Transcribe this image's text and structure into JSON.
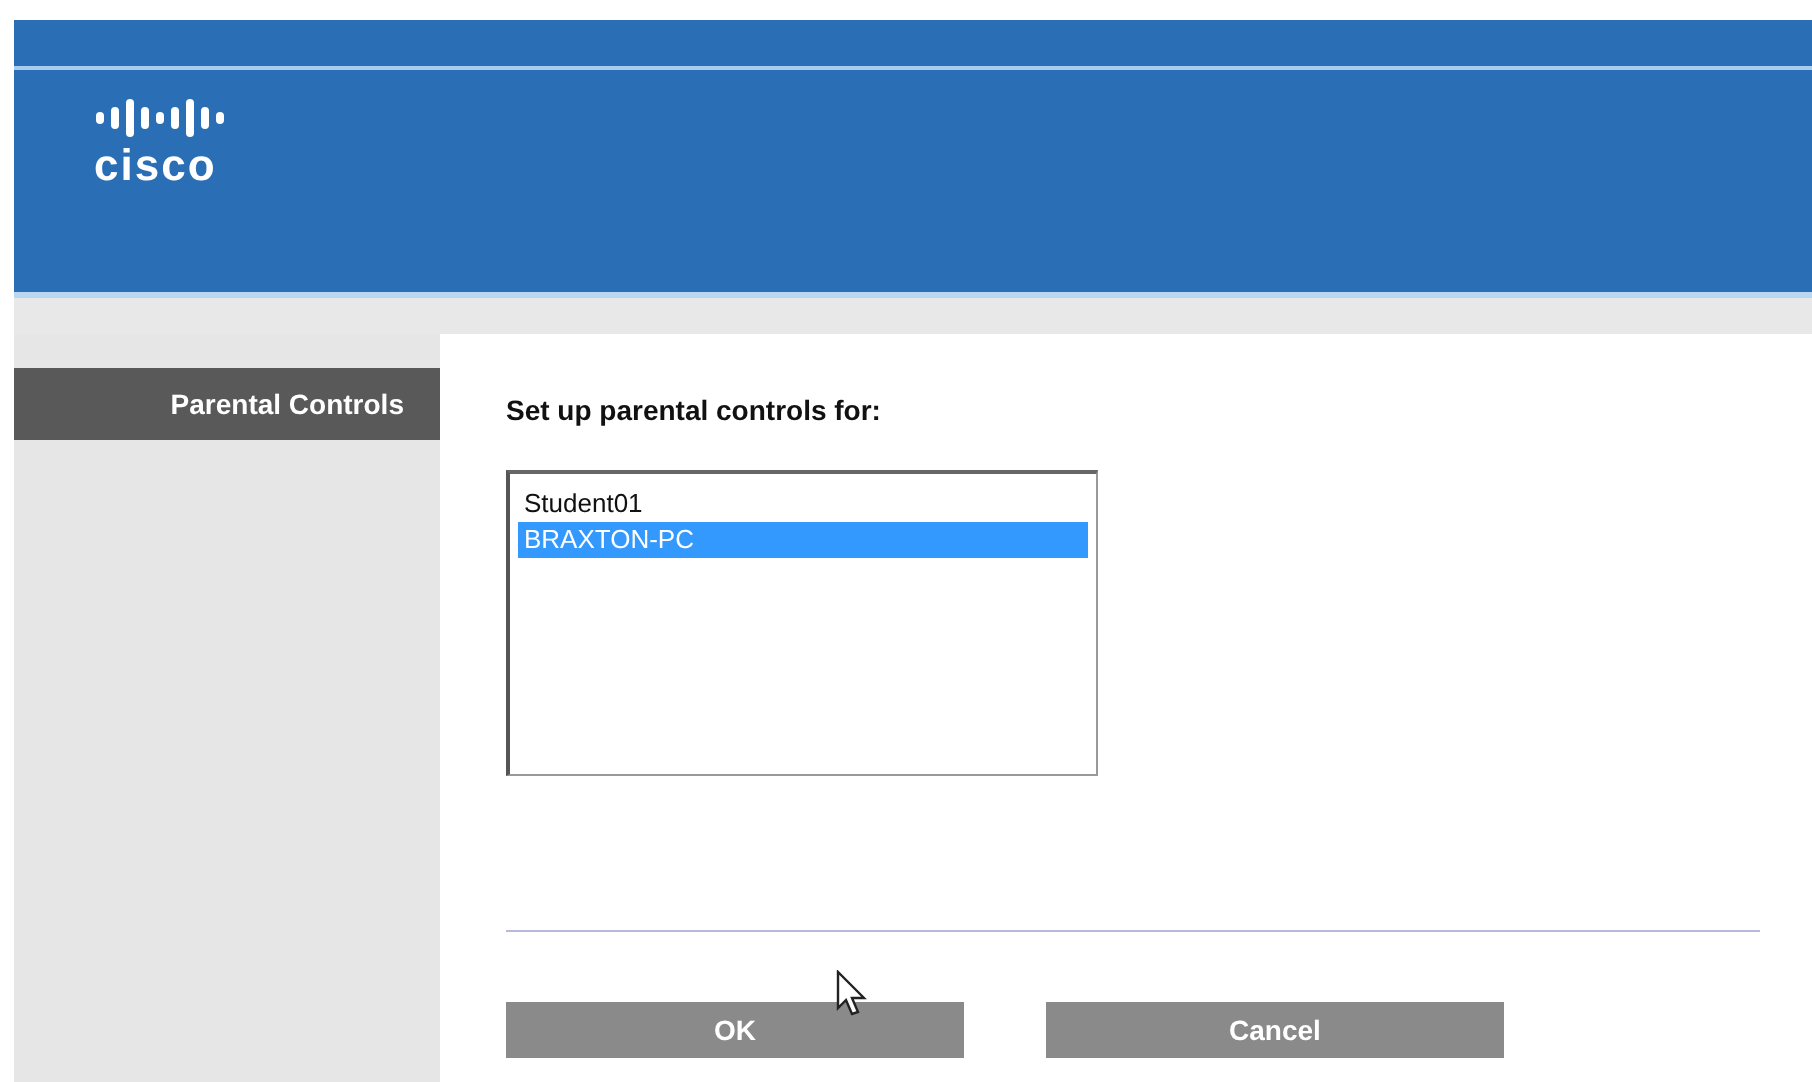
{
  "header": {
    "logo_text": "cisco"
  },
  "sidebar": {
    "items": [
      {
        "label": "Parental Controls",
        "selected": true
      }
    ]
  },
  "content": {
    "title": "Set up parental controls for:",
    "devices": [
      {
        "name": "Student01",
        "selected": false
      },
      {
        "name": "BRAXTON-PC",
        "selected": true
      }
    ]
  },
  "buttons": [
    "OK",
    "Cancel"
  ]
}
